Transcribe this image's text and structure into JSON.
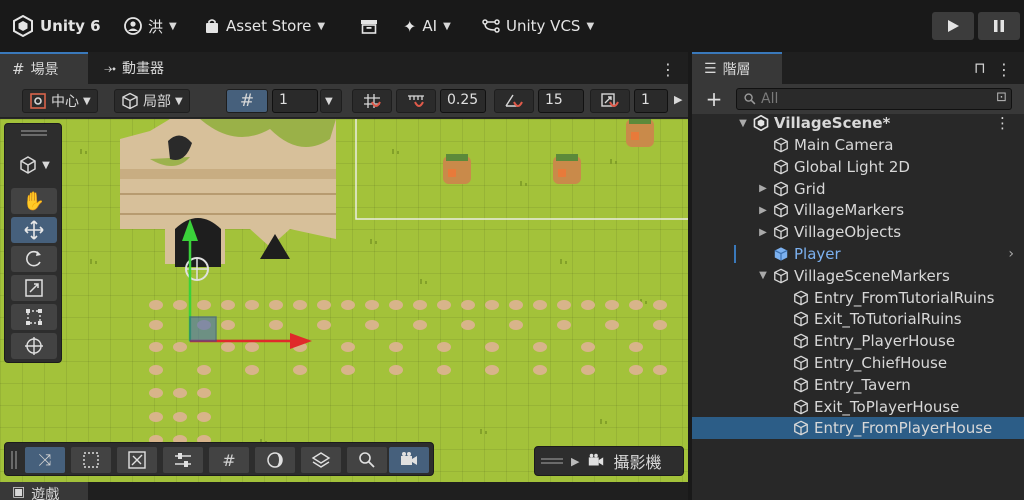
{
  "topbar": {
    "app_name": "Unity 6",
    "account": "洪",
    "asset_store": "Asset Store",
    "ai": "AI",
    "vcs": "Unity VCS"
  },
  "scene_tabs": [
    {
      "label": "場景",
      "icon": "grid-icon"
    },
    {
      "label": "動畫器",
      "icon": "animator-icon"
    }
  ],
  "scene_toolbar": {
    "pivot": "中心",
    "space": "局部",
    "grid_size": "1",
    "snap_move": "0.25",
    "snap_rotate": "15",
    "snap_scale": "1"
  },
  "camera_overlay": {
    "label": "攝影機"
  },
  "bottom_tab": {
    "label": "遊戲"
  },
  "hierarchy": {
    "tab_label": "階層",
    "search_placeholder": "All",
    "scene_name": "VillageScene*",
    "items": [
      {
        "label": "Main Camera",
        "indent": 1,
        "expand": ""
      },
      {
        "label": "Global Light 2D",
        "indent": 1,
        "expand": ""
      },
      {
        "label": "Grid",
        "indent": 1,
        "expand": "▶"
      },
      {
        "label": "VillageMarkers",
        "indent": 1,
        "expand": "▶"
      },
      {
        "label": "VillageObjects",
        "indent": 1,
        "expand": "▶"
      },
      {
        "label": "Player",
        "indent": 1,
        "expand": ""
      },
      {
        "label": "VillageSceneMarkers",
        "indent": 1,
        "expand": "▼"
      },
      {
        "label": "Entry_FromTutorialRuins",
        "indent": 2,
        "expand": ""
      },
      {
        "label": "Exit_ToTutorialRuins",
        "indent": 2,
        "expand": ""
      },
      {
        "label": "Entry_PlayerHouse",
        "indent": 2,
        "expand": ""
      },
      {
        "label": "Entry_ChiefHouse",
        "indent": 2,
        "expand": ""
      },
      {
        "label": "Entry_Tavern",
        "indent": 2,
        "expand": ""
      },
      {
        "label": "Exit_ToPlayerHouse",
        "indent": 2,
        "expand": ""
      },
      {
        "label": "Entry_FromPlayerHouse",
        "indent": 2,
        "expand": ""
      }
    ]
  },
  "colors": {
    "accent": "#3a79bb",
    "selection": "#2c5d87",
    "grass": "#a3c23a",
    "player_text": "#7cb1f0"
  }
}
